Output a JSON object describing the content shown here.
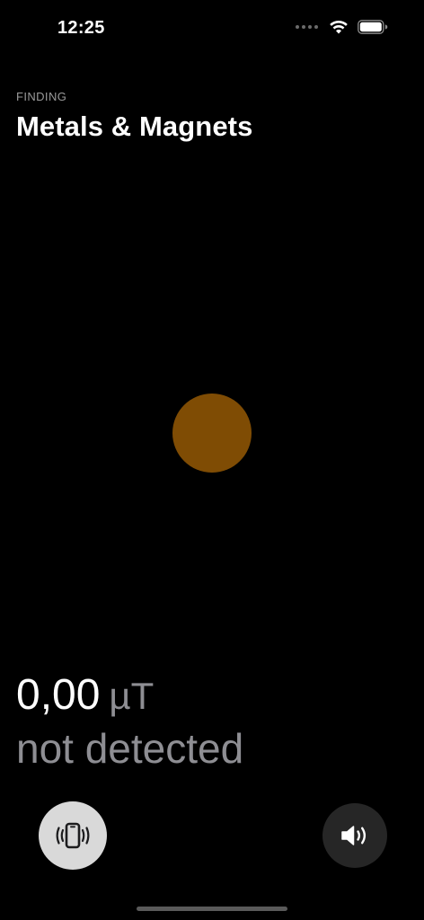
{
  "status_bar": {
    "time": "12:25",
    "icons": [
      "signal-icon",
      "wifi-icon",
      "battery-icon"
    ]
  },
  "header": {
    "subtitle": "FINDING",
    "title": "Metals & Magnets"
  },
  "indicator": {
    "color": "#7f4c04"
  },
  "reading": {
    "value": "0,00",
    "unit": "µT",
    "status": "not detected"
  },
  "controls": {
    "vibrate_icon": "phone-vibrate-icon",
    "sound_icon": "speaker-icon"
  }
}
